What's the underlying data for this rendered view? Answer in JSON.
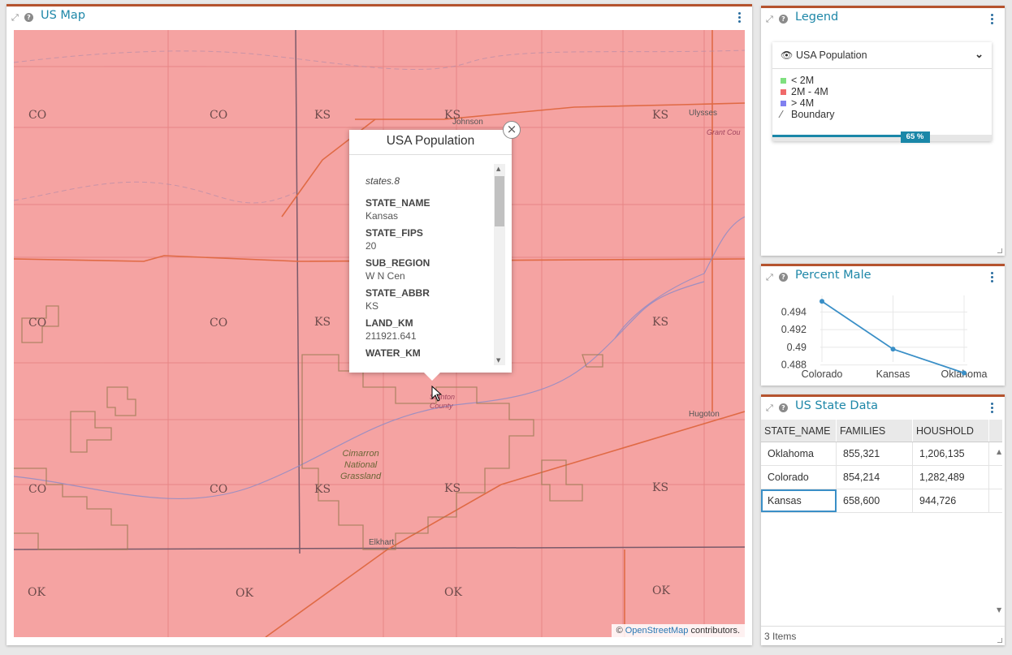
{
  "panels": {
    "map": {
      "title": "US Map"
    },
    "legend": {
      "title": "Legend"
    },
    "chart": {
      "title": "Percent Male"
    },
    "table": {
      "title": "US State Data"
    }
  },
  "map": {
    "state_labels": [
      "CO",
      "CO",
      "KS",
      "KS",
      "KS",
      "CO",
      "CO",
      "KS",
      "KS",
      "CO",
      "CO",
      "KS",
      "KS",
      "KS",
      "OK",
      "OK",
      "OK",
      "OK"
    ],
    "cities": {
      "johnson": "Johnson",
      "ulysses": "Ulysses",
      "hugoton": "Hugoton",
      "elkhart": "Elkhart"
    },
    "counties": {
      "grant": "Grant Cou",
      "stanton": "Stanton\nCounty"
    },
    "park": [
      "Cimarron",
      "National",
      "Grassland"
    ],
    "attribution": {
      "prefix": "©",
      "link": "OpenStreetMap",
      "suffix": "contributors."
    },
    "fill_color": "#f5a3a2"
  },
  "popup": {
    "title": "USA Population",
    "layer_name": "states.8",
    "fields": [
      {
        "key": "STATE_NAME",
        "value": "Kansas"
      },
      {
        "key": "STATE_FIPS",
        "value": "20"
      },
      {
        "key": "SUB_REGION",
        "value": "W N Cen"
      },
      {
        "key": "STATE_ABBR",
        "value": "KS"
      },
      {
        "key": "LAND_KM",
        "value": "211921.641"
      },
      {
        "key": "WATER_KM",
        "value": ""
      }
    ]
  },
  "legend": {
    "layer_name": "USA Population",
    "items": [
      {
        "label": "< 2M",
        "color": "#7fe07f"
      },
      {
        "label": "2M - 4M",
        "color": "#f06a6a"
      },
      {
        "label": "> 4M",
        "color": "#8080f0"
      },
      {
        "label": "Boundary",
        "color": "#555555"
      }
    ],
    "opacity_label": "65 %",
    "opacity": 0.65
  },
  "chart_data": {
    "type": "line",
    "categories": [
      "Colorado",
      "Kansas",
      "Oklahoma"
    ],
    "values": [
      0.4952,
      0.4898,
      0.4871
    ],
    "yticks": [
      "0.494",
      "0.492",
      "0.49",
      "0.488"
    ],
    "ytick_values": [
      0.494,
      0.492,
      0.49,
      0.488
    ],
    "ylim": [
      0.4865,
      0.4955
    ],
    "color": "#3a8fc7",
    "grid": true
  },
  "table": {
    "columns": [
      "STATE_NAME",
      "FAMILIES",
      "HOUSHOLD"
    ],
    "rows": [
      [
        "Oklahoma",
        "855,321",
        "1,206,135"
      ],
      [
        "Colorado",
        "854,214",
        "1,282,489"
      ],
      [
        "Kansas",
        "658,600",
        "944,726"
      ]
    ],
    "footer": "3 Items"
  }
}
